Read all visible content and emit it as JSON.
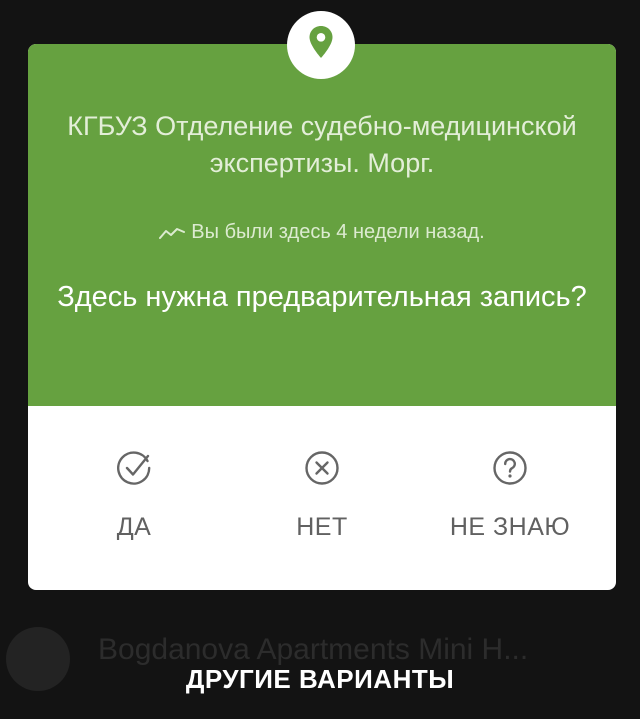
{
  "background_item": {
    "text": "Bogdanova Apartments Mini H..."
  },
  "card": {
    "place_name": "КГБУЗ Отделение судебно-медицинской экспертизы. Морг.",
    "visit_info": "Вы были здесь 4 недели назад.",
    "question": "Здесь нужна предварительная запись?",
    "header_color": "#66a140",
    "icon": "map-pin-icon"
  },
  "answers": [
    {
      "label": "ДА",
      "icon": "check-circle-icon"
    },
    {
      "label": "НЕТ",
      "icon": "x-circle-icon"
    },
    {
      "label": "НЕ ЗНАЮ",
      "icon": "question-circle-icon"
    }
  ],
  "other_options_label": "ДРУГИЕ ВАРИАНТЫ"
}
